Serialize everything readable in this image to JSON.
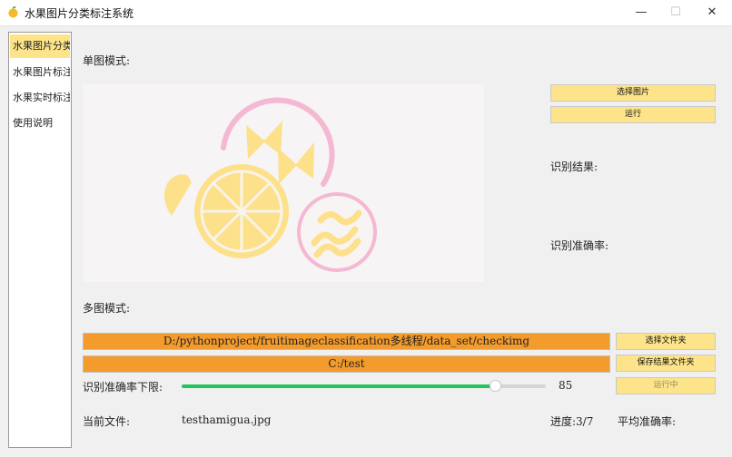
{
  "window": {
    "title": "水果图片分类标注系统",
    "minimize_glyph": "—",
    "maximize_glyph": "☐",
    "close_glyph": "✕"
  },
  "sidebar": {
    "items": [
      {
        "label": "水果图片分类",
        "active": true
      },
      {
        "label": "水果图片标注",
        "active": false
      },
      {
        "label": "水果实时标注",
        "active": false
      },
      {
        "label": "使用说明",
        "active": false
      }
    ]
  },
  "single": {
    "section_label": "单图模式:",
    "select_image_button": "选择图片",
    "run_button": "运行",
    "result_label": "识别结果:",
    "accuracy_label": "识别准确率:"
  },
  "multi": {
    "section_label": "多图模式:",
    "source_path": "D:/pythonproject/fruitimageclassification多线程/data_set/checkimg",
    "output_path": "C:/test",
    "select_folder_button": "选择文件夹",
    "save_folder_button": "保存结果文件夹",
    "running_button": "运行中",
    "threshold_label": "识别准确率下限:",
    "threshold_value": "85",
    "threshold_fraction": 0.86,
    "current_file_label": "当前文件:",
    "current_file": "testhamigua.jpg",
    "progress": "进度:3/7",
    "avg_accuracy_label": "平均准确率:"
  },
  "colors": {
    "accent_yellow": "#fde48a",
    "path_orange": "#f39b2c",
    "slider_green": "#22c55e"
  },
  "icons": [
    "fruit-app-icon",
    "minimize-icon",
    "maximize-icon",
    "close-icon"
  ]
}
